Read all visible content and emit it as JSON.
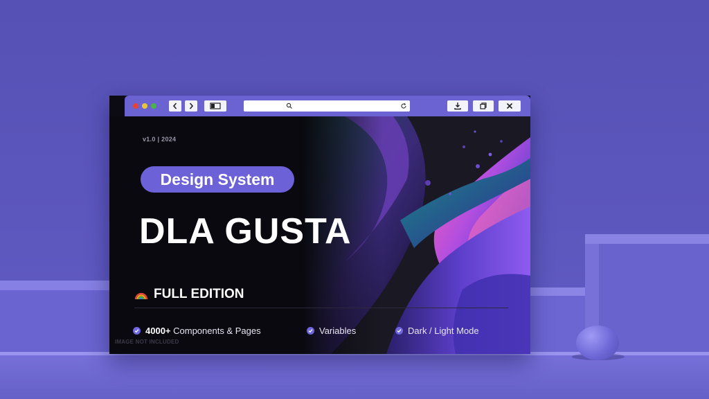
{
  "browser": {
    "traffic_lights": [
      "#e0443a",
      "#e8c43a",
      "#4bb24a"
    ],
    "back_icon": "chevron-left-icon",
    "forward_icon": "chevron-right-icon",
    "sidebar_icon": "sidebar-icon",
    "search_icon": "search-icon",
    "reload_icon": "reload-icon",
    "download_icon": "download-icon",
    "tabs_icon": "tabs-icon",
    "close_icon": "close-icon"
  },
  "hero": {
    "version": "v1.0 | 2024",
    "tag": "Design System",
    "title": "DLA GUSTA",
    "edition": "FULL EDITION",
    "edition_icon": "rainbow-icon"
  },
  "features": [
    {
      "strong": "4000+",
      "text": " Components & Pages"
    },
    {
      "strong": "",
      "text": "Variables"
    },
    {
      "strong": "",
      "text": "Dark / Light Mode"
    }
  ],
  "footnote": "IMAGE NOT INCLUDED",
  "colors": {
    "background": "#5a55b8",
    "accent": "#6c61d6",
    "titlebar": "#6b63d1"
  }
}
